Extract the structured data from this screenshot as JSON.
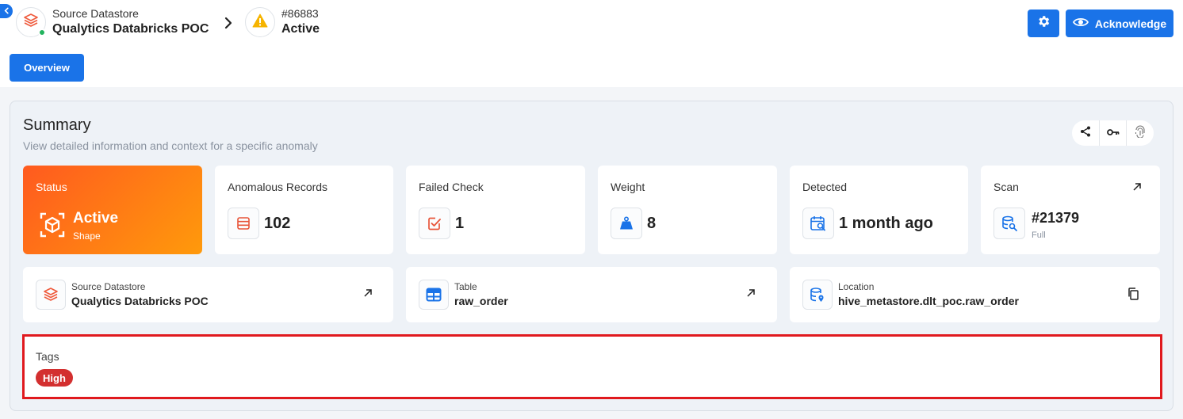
{
  "header": {
    "datastore_label": "Source Datastore",
    "datastore_name": "Qualytics Databricks POC",
    "anomaly_id": "#86883",
    "anomaly_status": "Active",
    "acknowledge_label": "Acknowledge"
  },
  "tabs": {
    "overview_label": "Overview"
  },
  "summary": {
    "title": "Summary",
    "subtitle": "View detailed information and context for a specific anomaly"
  },
  "cards": {
    "status": {
      "label": "Status",
      "value": "Active",
      "sub": "Shape"
    },
    "records": {
      "label": "Anomalous Records",
      "value": "102"
    },
    "failed": {
      "label": "Failed Check",
      "value": "1"
    },
    "weight": {
      "label": "Weight",
      "value": "8"
    },
    "detected": {
      "label": "Detected",
      "value": "1 month ago"
    },
    "scan": {
      "label": "Scan",
      "value": "#21379",
      "sub": "Full"
    }
  },
  "info": {
    "datastore": {
      "label": "Source Datastore",
      "value": "Qualytics Databricks POC"
    },
    "table": {
      "label": "Table",
      "value": "raw_order"
    },
    "location": {
      "label": "Location",
      "value": "hive_metastore.dlt_poc.raw_order"
    }
  },
  "tags": {
    "label": "Tags",
    "items": [
      "High"
    ]
  },
  "colors": {
    "primary": "#1a73e8",
    "status_gradient_start": "#ff5a1f",
    "status_gradient_end": "#ff9a0b",
    "tag_high": "#d32f2f",
    "highlight_border": "#e0191e"
  }
}
